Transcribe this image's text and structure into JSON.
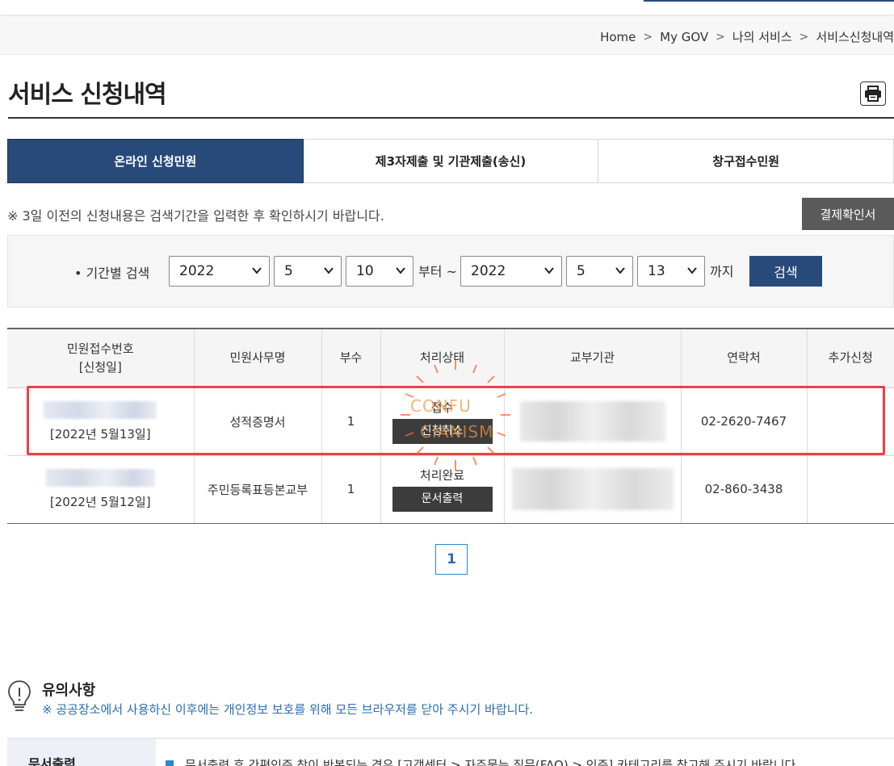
{
  "breadcrumb": [
    "Home",
    "My GOV",
    "나의 서비스",
    "서비스신청내역"
  ],
  "page": {
    "title": "서비스 신청내역"
  },
  "tabs": [
    {
      "label": "온라인 신청민원",
      "active": true
    },
    {
      "label": "제3자제출 및 기관제출(송신)",
      "active": false
    },
    {
      "label": "창구접수민원",
      "active": false
    }
  ],
  "notice": "※ 3일 이전의 신청내용은 검색기간을 입력한 후 확인하시기 바랍니다.",
  "receipt_button": "결제확인서",
  "search": {
    "label": "• 기간별 검색",
    "from": {
      "year": "2022",
      "month": "5",
      "day": "10"
    },
    "from_suffix": "부터 ~",
    "to": {
      "year": "2022",
      "month": "5",
      "day": "13"
    },
    "to_suffix": "까지",
    "button": "검색"
  },
  "table": {
    "headers": [
      "민원접수번호\n[신청일]",
      "민원사무명",
      "부수",
      "처리상태",
      "교부기관",
      "연락처",
      "추가신청"
    ],
    "rows": [
      {
        "date": "[2022년 5월13일]",
        "name": "성적증명서",
        "copies": "1",
        "status": "접수",
        "action": "신청취소",
        "phone": "02-2620-7467"
      },
      {
        "date": "[2022년 5월12일]",
        "name": "주민등록표등본교부",
        "copies": "1",
        "status": "처리완료",
        "action": "문서출력",
        "phone": "02-860-3438"
      }
    ]
  },
  "watermark": {
    "line1": "CONFU",
    "line2": "CIANISM"
  },
  "pagination": {
    "current": "1"
  },
  "caution": {
    "title": "유의사항",
    "text": "※ 공공장소에서 사용하신 이후에는 개인정보 보호를 위해 모든 브라우저를 닫아 주시기 바랍니다."
  },
  "doc_output": {
    "label": "문서출력",
    "text": "문서출력 후 간편인증 창이 반복되는 경우 [고객센터 > 자주묻는 질문(FAQ) > 인증] 카테고리를 참고해 주시기 바랍니다."
  },
  "colors": {
    "primary": "#274a7b",
    "highlight": "#ee4045",
    "link": "#2a6db0"
  }
}
